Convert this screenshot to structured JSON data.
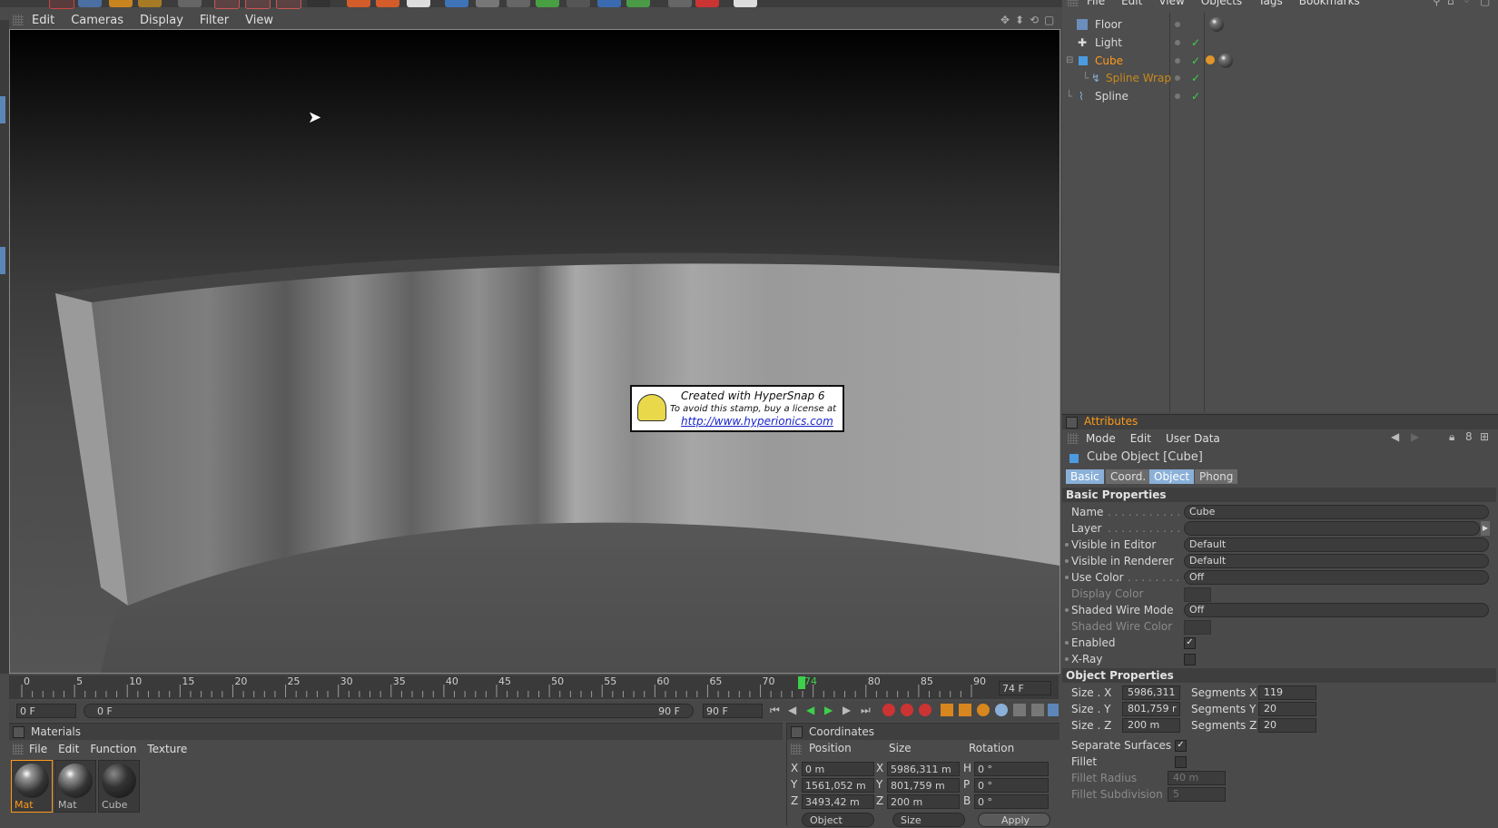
{
  "viewport": {
    "menu": [
      "Edit",
      "Cameras",
      "Display",
      "Filter",
      "View"
    ],
    "stamp": {
      "line1": "Created with HyperSnap 6",
      "line2": "To avoid this stamp, buy a license at",
      "line3": "http://www.hyperionics.com"
    }
  },
  "object_manager": {
    "menu": [
      "File",
      "Edit",
      "View",
      "Objects",
      "Tags",
      "Bookmarks"
    ],
    "objects": [
      {
        "name": "Floor",
        "color": "#d8d8d8"
      },
      {
        "name": "Light",
        "color": "#d8d8d8"
      },
      {
        "name": "Cube",
        "color": "#ff9a1a"
      },
      {
        "name": "Spline Wrap",
        "color": "#c8881a"
      },
      {
        "name": "Spline",
        "color": "#d8d8d8"
      }
    ]
  },
  "attributes": {
    "title": "Attributes",
    "menu": [
      "Mode",
      "Edit",
      "User Data"
    ],
    "object_title": "Cube Object [Cube]",
    "tabs": [
      "Basic",
      "Coord.",
      "Object",
      "Phong"
    ],
    "basic_header": "Basic Properties",
    "basic": {
      "name_label": "Name",
      "name_value": "Cube",
      "layer_label": "Layer",
      "vis_editor_label": "Visible in Editor",
      "vis_editor_value": "Default",
      "vis_renderer_label": "Visible in Renderer",
      "vis_renderer_value": "Default",
      "use_color_label": "Use Color",
      "use_color_value": "Off",
      "display_color_label": "Display Color",
      "shaded_wire_mode_label": "Shaded Wire Mode",
      "shaded_wire_mode_value": "Off",
      "shaded_wire_color_label": "Shaded Wire Color",
      "enabled_label": "Enabled",
      "xray_label": "X-Ray"
    },
    "object_header": "Object Properties",
    "object": {
      "size_x_label": "Size . X",
      "size_x_value": "5986,311",
      "size_y_label": "Size . Y",
      "size_y_value": "801,759 r",
      "size_z_label": "Size . Z",
      "size_z_value": "200 m",
      "seg_x_label": "Segments X",
      "seg_x_value": "119",
      "seg_y_label": "Segments Y",
      "seg_y_value": "20",
      "seg_z_label": "Segments Z",
      "seg_z_value": "20",
      "separate_label": "Separate Surfaces",
      "fillet_label": "Fillet",
      "fillet_radius_label": "Fillet Radius",
      "fillet_radius_value": "40 m",
      "fillet_sub_label": "Fillet Subdivision",
      "fillet_sub_value": "5"
    }
  },
  "timeline": {
    "ticks": [
      "0",
      "5",
      "10",
      "15",
      "20",
      "25",
      "30",
      "35",
      "40",
      "45",
      "50",
      "55",
      "60",
      "65",
      "70",
      "74",
      "80",
      "85",
      "90"
    ],
    "current_label": "74 F",
    "current_frame": 74,
    "max_frame": 90,
    "start_field": "0 F",
    "range_start": "0 F",
    "range_end": "90 F",
    "end_field": "90 F"
  },
  "materials": {
    "title": "Materials",
    "menu": [
      "File",
      "Edit",
      "Function",
      "Texture"
    ],
    "items": [
      {
        "label": "Mat",
        "selected": true
      },
      {
        "label": "Mat",
        "selected": false
      },
      {
        "label": "Cube",
        "selected": false
      }
    ]
  },
  "coordinates": {
    "title": "Coordinates",
    "headers": [
      "Position",
      "Size",
      "Rotation"
    ],
    "rows": [
      {
        "axis": "X",
        "pos": "0 m",
        "saxis": "X",
        "size": "5986,311 m",
        "raxis": "H",
        "rot": "0 °"
      },
      {
        "axis": "Y",
        "pos": "1561,052 m",
        "saxis": "Y",
        "size": "801,759 m",
        "raxis": "P",
        "rot": "0 °"
      },
      {
        "axis": "Z",
        "pos": "3493,42 m",
        "saxis": "Z",
        "size": "200 m",
        "raxis": "B",
        "rot": "0 °"
      }
    ],
    "mode_select": "Object",
    "size_select": "Size",
    "apply_label": "Apply"
  },
  "colors": {
    "accent_orange": "#ff9a1a",
    "tab_blue": "#8ab0d8",
    "check_green": "#3ed04a"
  }
}
